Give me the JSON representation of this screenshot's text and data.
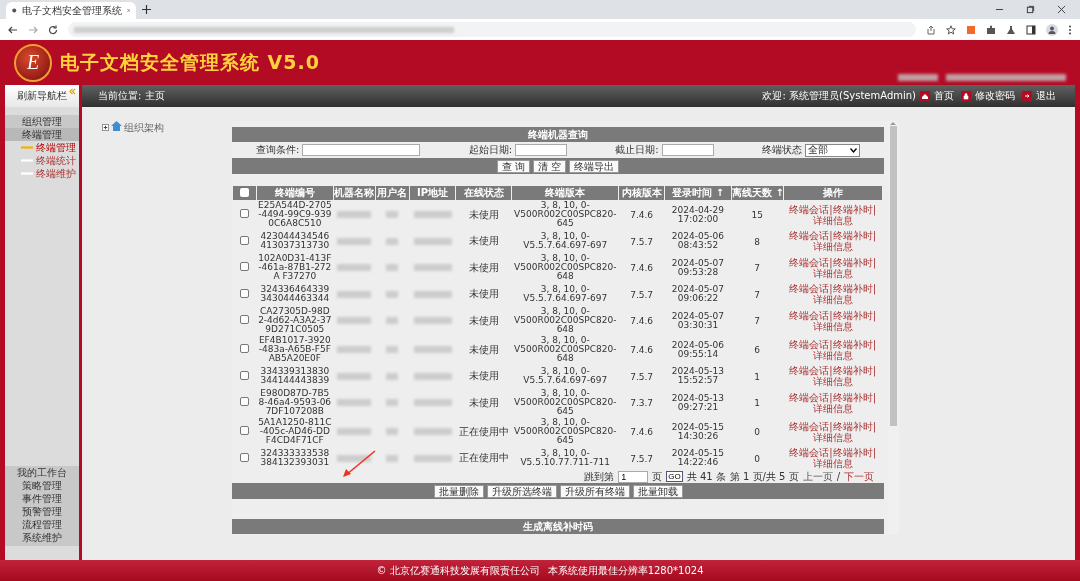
{
  "browser": {
    "tab_title": "电子文档安全管理系统"
  },
  "header": {
    "logo_text": "E",
    "title": "电子文档安全管理系统 V5.0"
  },
  "nav": {
    "breadcrumb": "当前位置: 主页",
    "welcome": "欢迎: 系统管理员(SystemAdmin)",
    "links": [
      {
        "kind": "home",
        "label": "首页"
      },
      {
        "kind": "password",
        "label": "修改密码"
      },
      {
        "kind": "logout",
        "label": "退出"
      }
    ]
  },
  "sidebar": {
    "title": "刷新导航栏",
    "items": [
      {
        "label": "组织管理"
      },
      {
        "label": "终端管理",
        "expanded": true,
        "children": [
          {
            "label": "终端管理",
            "selected": true
          },
          {
            "label": "终端统计",
            "selected": false
          },
          {
            "label": "终端维护",
            "selected": false
          }
        ]
      }
    ],
    "bottom_items": [
      "我的工作台",
      "策略管理",
      "事件管理",
      "预警管理",
      "流程管理",
      "系统维护"
    ]
  },
  "tree": {
    "label": "组织架构",
    "expanded": false
  },
  "query": {
    "title": "终端机器查询",
    "fields": [
      {
        "kind": "text",
        "label": "查询条件:"
      },
      {
        "kind": "date",
        "label": "起始日期:"
      },
      {
        "kind": "date",
        "label": "截止日期:"
      },
      {
        "kind": "select",
        "label": "终端状态",
        "value": "全部"
      }
    ],
    "buttons": [
      "查 询",
      "清 空",
      "终端导出"
    ]
  },
  "table": {
    "select_all": false,
    "action_separator": "|",
    "columns": [
      {
        "label": "终端编号"
      },
      {
        "label": "机器名称"
      },
      {
        "label": "用户名"
      },
      {
        "label": "IP地址"
      },
      {
        "label": "在线状态"
      },
      {
        "label": "终端版本"
      },
      {
        "label": "内核版本"
      },
      {
        "label": "登录时间",
        "sort_mark": "↑"
      },
      {
        "label": "离线天数",
        "sort_mark": "↑"
      },
      {
        "label": "操作"
      }
    ],
    "rows": [
      {
        "checked": false,
        "id": "E25A544D-2705-4494-99C9-9390C6A8C510",
        "status": "未使用",
        "version": "3, 8, 10, 0-V500R002C00SPC820-645",
        "kernel": "7.4.6",
        "login_time": "2024-04-29 17:02:00",
        "offline_days": "15",
        "actions": [
          "终端会话",
          "终端补时",
          "详细信息"
        ]
      },
      {
        "checked": false,
        "id": "423044434546413037313730",
        "status": "未使用",
        "version": "3, 8, 10, 0-V5.5.7.64.697-697",
        "kernel": "7.5.7",
        "login_time": "2024-05-06 08:43:52",
        "offline_days": "8",
        "actions": [
          "终端会话",
          "终端补时",
          "详细信息"
        ]
      },
      {
        "checked": false,
        "id": "102A0D31-413F-461a-87B1-272A F37270",
        "status": "未使用",
        "version": "3, 8, 10, 0-V500R002C00SPC820-648",
        "kernel": "7.4.6",
        "login_time": "2024-05-07 09:53:28",
        "offline_days": "7",
        "actions": [
          "终端会话",
          "终端补时",
          "详细信息"
        ]
      },
      {
        "checked": false,
        "id": "324336464339343044463344",
        "status": "未使用",
        "version": "3, 8, 10, 0-V5.5.7.64.697-697",
        "kernel": "7.5.7",
        "login_time": "2024-05-07 09:06:22",
        "offline_days": "7",
        "actions": [
          "终端会话",
          "终端补时",
          "详细信息"
        ]
      },
      {
        "checked": false,
        "id": "CA27305D-98D2-4d62-A3A2-379D271C0505",
        "status": "未使用",
        "version": "3, 8, 10, 0-V500R002C00SPC820-648",
        "kernel": "7.4.6",
        "login_time": "2024-05-07 03:30:31",
        "offline_days": "7",
        "actions": [
          "终端会话",
          "终端补时",
          "详细信息"
        ]
      },
      {
        "checked": false,
        "id": "EF4B1017-3920-483a-A65B-F5FAB5A20E0F",
        "status": "未使用",
        "version": "3, 8, 10, 0-V500R002C00SPC820-648",
        "kernel": "7.4.6",
        "login_time": "2024-05-06 09:55:14",
        "offline_days": "6",
        "actions": [
          "终端会话",
          "终端补时",
          "详细信息"
        ]
      },
      {
        "checked": false,
        "id": "334339313830344144443839",
        "status": "未使用",
        "version": "3, 8, 10, 0-V5.5.7.64.697-697",
        "kernel": "7.5.7",
        "login_time": "2024-05-13 15:52:57",
        "offline_days": "1",
        "actions": [
          "终端会话",
          "终端补时",
          "详细信息"
        ]
      },
      {
        "checked": false,
        "id": "E980D87D-7B58-46a4-9593-067DF107208B",
        "status": "未使用",
        "version": "3, 8, 10, 0-V500R002C00SPC820-645",
        "kernel": "7.3.7",
        "login_time": "2024-05-13 09:27:21",
        "offline_days": "1",
        "actions": [
          "终端会话",
          "终端补时",
          "详细信息"
        ]
      },
      {
        "checked": false,
        "id": "5A1A1250-811C-405c-AD46-DDF4CD4F71CF",
        "status": "正在使用中",
        "version": "3, 8, 10, 0-V500R002C00SPC820-645",
        "kernel": "7.4.6",
        "login_time": "2024-05-15 14:30:26",
        "offline_days": "0",
        "actions": [
          "终端会话",
          "终端补时",
          "详细信息"
        ]
      },
      {
        "checked": false,
        "id": "324333333538384132393031",
        "status": "正在使用中",
        "version": "3, 8, 10, 0-V5.5.10.77.711-711",
        "kernel": "7.5.7",
        "login_time": "2024-05-15 14:22:46",
        "offline_days": "0",
        "actions": [
          "终端会话",
          "终端补时",
          "详细信息"
        ]
      }
    ]
  },
  "pagination": {
    "jump_label": "跳到第",
    "page_input": "1",
    "page_suffix": "页",
    "go": "GO",
    "total": "共 41 条",
    "page_info": "第 1 页/共 5 页",
    "prev": {
      "label": "上一页",
      "disabled": true
    },
    "separator": "/",
    "next": {
      "label": "下一页",
      "disabled": false
    }
  },
  "bulk_buttons": [
    "批量删除",
    "升级所选终端",
    "升级所有终端",
    "批量卸载"
  ],
  "section": {
    "title": "生成离线补时码"
  },
  "footer": {
    "copyright": "© 北京亿赛通科技发展有限责任公司",
    "resolution": "本系统使用最佳分辨率1280*1024"
  }
}
